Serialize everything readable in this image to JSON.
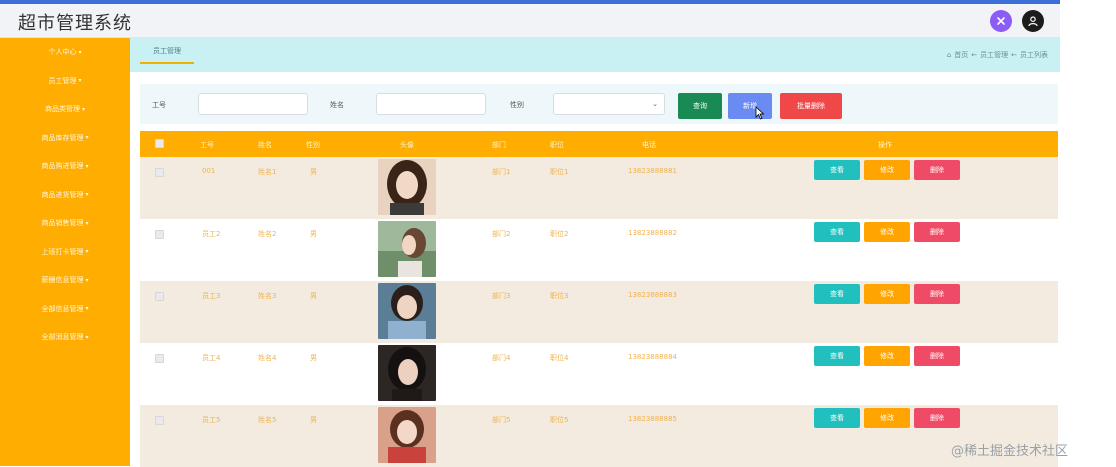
{
  "app": {
    "title": "超市管理系统"
  },
  "header": {
    "icons": [
      "settings-icon",
      "user-icon"
    ]
  },
  "sidebar": {
    "items": [
      {
        "label": "个人中心"
      },
      {
        "label": "员工管理"
      },
      {
        "label": "商品类管理"
      },
      {
        "label": "商品库存管理"
      },
      {
        "label": "商品购进管理"
      },
      {
        "label": "商品进货管理"
      },
      {
        "label": "商品销售管理"
      },
      {
        "label": "上班打卡管理"
      },
      {
        "label": "薪酬信息管理"
      },
      {
        "label": "全部信息管理"
      },
      {
        "label": "全部消息管理"
      }
    ]
  },
  "tabs": [
    {
      "label": "员工管理"
    }
  ],
  "breadcrumb": {
    "items": [
      "首页",
      "员工管理",
      "员工列表"
    ]
  },
  "search": {
    "label_id": "工号",
    "label_name": "姓名",
    "label_gender": "性别",
    "id_value": "",
    "name_value": "",
    "gender_value": "",
    "btn_query": "查询",
    "btn_add": "新增",
    "btn_batch_delete": "批量删除"
  },
  "table": {
    "columns": [
      "工号",
      "姓名",
      "性别",
      "头像",
      "部门",
      "职位",
      "电话",
      "操作"
    ],
    "actions": {
      "view": "查看",
      "edit": "修改",
      "delete": "删除"
    },
    "rows": [
      {
        "id": "001",
        "name": "姓名1",
        "gender": "男",
        "dept": "部门1",
        "position": "职位1",
        "phone": "13823888881"
      },
      {
        "id": "员工2",
        "name": "姓名2",
        "gender": "男",
        "dept": "部门2",
        "position": "职位2",
        "phone": "13823888882"
      },
      {
        "id": "员工3",
        "name": "姓名3",
        "gender": "男",
        "dept": "部门3",
        "position": "职位3",
        "phone": "13823888883"
      },
      {
        "id": "员工4",
        "name": "姓名4",
        "gender": "男",
        "dept": "部门4",
        "position": "职位4",
        "phone": "13823888884"
      },
      {
        "id": "员工5",
        "name": "姓名5",
        "gender": "男",
        "dept": "部门5",
        "position": "职位5",
        "phone": "13823888885"
      }
    ]
  },
  "watermark": "@稀土掘金技术社区",
  "colors": {
    "accent": "#ffad00",
    "tab_bg": "#c9f1f4",
    "view": "#22bfbf",
    "edit": "#ffa400",
    "delete": "#ef4b66"
  }
}
